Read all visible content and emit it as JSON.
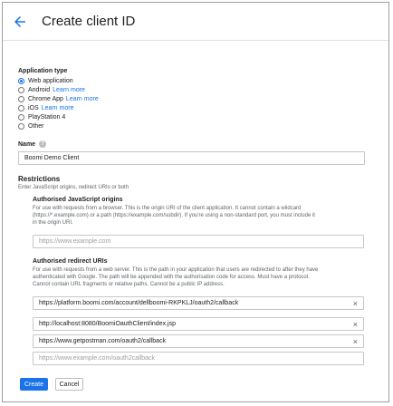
{
  "header": {
    "title": "Create client ID"
  },
  "app_type": {
    "label": "Application type",
    "options": [
      {
        "label": "Web application",
        "link": "",
        "selected": true
      },
      {
        "label": "Android",
        "link": "Learn more",
        "selected": false
      },
      {
        "label": "Chrome App",
        "link": "Learn more",
        "selected": false
      },
      {
        "label": "iOS",
        "link": "Learn more",
        "selected": false
      },
      {
        "label": "PlayStation 4",
        "link": "",
        "selected": false
      },
      {
        "label": "Other",
        "link": "",
        "selected": false
      }
    ]
  },
  "name": {
    "label": "Name",
    "value": "Boomi Demo Client"
  },
  "restrictions": {
    "title": "Restrictions",
    "description": "Enter JavaScript origins, redirect URIs or both",
    "origins": {
      "title": "Authorised JavaScript origins",
      "description_lines": [
        "For use with requests from a browser. This is the origin URI of the client application. It cannot contain a wildcard",
        "(https://*.example.com) or a path (https://example.com/subdir). If you're using a non-standard port, you must include it",
        "in the origin URI."
      ],
      "placeholder": "https://www.example.com"
    },
    "redirects": {
      "title": "Authorised redirect URIs",
      "description_lines": [
        "For use with requests from a web server. This is the path in your application that users are redirected to after they have",
        "authenticated with Google. The path will be appended with the authorisation code for access. Must have a protocol.",
        "Cannot contain URL fragments or relative paths. Cannot be a public IP address."
      ],
      "uris": [
        "https://platform.boomi.com/account/dellboomi-RKPKLJ/oauth2/callback",
        "http://localhost:8080/BoomiOauthClient/index.jsp",
        "https://www.getpostman.com/oauth2/callback"
      ],
      "placeholder": "https://www.example.com/oauth2callback"
    }
  },
  "buttons": {
    "create": "Create",
    "cancel": "Cancel"
  },
  "icons": {
    "remove": "×"
  }
}
